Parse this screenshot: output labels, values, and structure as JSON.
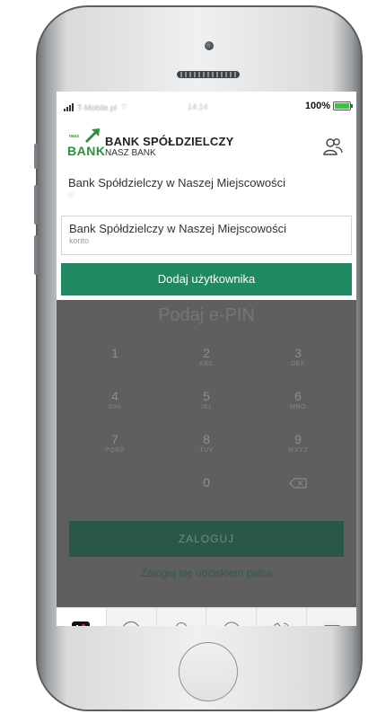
{
  "status_bar": {
    "carrier": "T-Mobile.pl",
    "time": "14:14",
    "battery": "100%"
  },
  "header": {
    "logo_small": "nasz",
    "logo_text": "BANK",
    "bank_name": "BANK SPÓŁDZIELCZY",
    "bank_sub": "NASZ BANK"
  },
  "accounts": [
    {
      "title": "Bank Spółdzielczy w Naszej Miejscowości",
      "sub": "••"
    },
    {
      "title": "Bank Spółdzielczy w Naszej Miejscowości",
      "sub": "konto"
    }
  ],
  "add_user_label": "Dodaj użytkownika",
  "pin_prompt": "Podaj e-PIN",
  "keypad": [
    {
      "digit": "1",
      "letters": ""
    },
    {
      "digit": "2",
      "letters": "ABC"
    },
    {
      "digit": "3",
      "letters": "DEF"
    },
    {
      "digit": "4",
      "letters": "GHI"
    },
    {
      "digit": "5",
      "letters": "JKL"
    },
    {
      "digit": "6",
      "letters": "MNO"
    },
    {
      "digit": "7",
      "letters": "PQRS"
    },
    {
      "digit": "8",
      "letters": "TUV"
    },
    {
      "digit": "9",
      "letters": "WXYZ"
    },
    {
      "digit": "0",
      "letters": ""
    }
  ],
  "login_label": "ZALOGUJ",
  "fingerprint_label": "Zaloguj się odciskiem palca",
  "tabs": [
    "bank-app-icon",
    "qr-code-icon",
    "location-pin-icon",
    "info-icon",
    "phone-icon",
    "mail-icon"
  ],
  "colors": {
    "brand_green": "#1f8a62",
    "logo_green": "#2e8f3e",
    "dim_overlay": "#5f5f5f"
  }
}
